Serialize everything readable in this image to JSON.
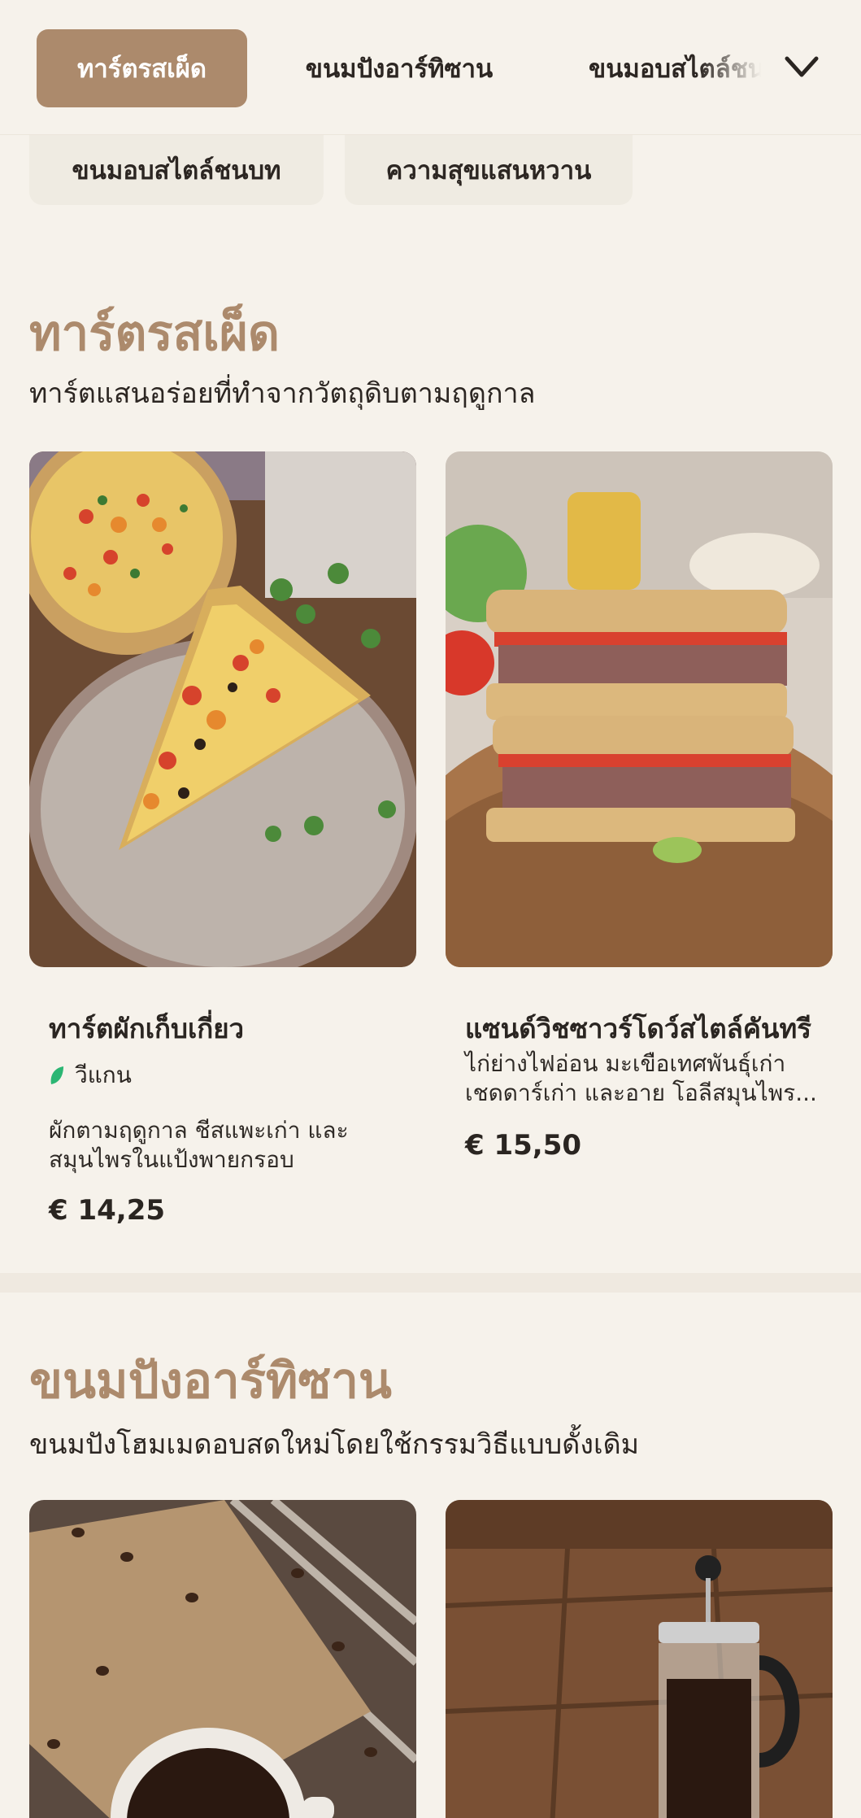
{
  "nav": {
    "tabs": [
      {
        "label": "ทาร์ตรสเผ็ด",
        "active": true
      },
      {
        "label": "ขนมปังอาร์ทิซาน",
        "active": false
      },
      {
        "label": "ขนมอบสไตล์ชนบท",
        "active": false
      }
    ],
    "overflow_chips": [
      {
        "label": "ขนมอบสไตล์ชนบท"
      },
      {
        "label": "ความสุขแสนหวาน"
      }
    ],
    "expand_icon": "chevron-down-icon"
  },
  "sections": [
    {
      "title": "ทาร์ตรสเผ็ด",
      "subtitle": "ทาร์ตแสนอร่อยที่ทำจากวัตถุดิบตามฤดูกาล",
      "items": [
        {
          "name": "ทาร์ตผักเก็บเกี่ยว",
          "badge": "วีแกน",
          "badge_icon": "leaf-icon",
          "description_lines": [
            "ผักตามฤดูกาล ชีสแพะเก่า และ",
            "สมุนไพรในแป้งพายกรอบ"
          ],
          "price": "€ 14,25"
        },
        {
          "name": "แซนด์วิชซาวร์โดว์สไตล์คันทรี",
          "description_lines": [
            "ไก่ย่างไฟอ่อน มะเขือเทศพันธุ์เก่า",
            "เชดดาร์เก่า และอาย โอลีสมุนไพร..."
          ],
          "price": "€ 15,50"
        }
      ]
    },
    {
      "title": "ขนมปังอาร์ทิซาน",
      "subtitle": "ขนมปังโฮมเมดอบสดใหม่โดยใช้กรรมวิธีแบบดั้งเดิม"
    }
  ],
  "colors": {
    "accent": "#ac8a6c",
    "background": "#f6f2eb",
    "vegan": "#2bb673"
  }
}
